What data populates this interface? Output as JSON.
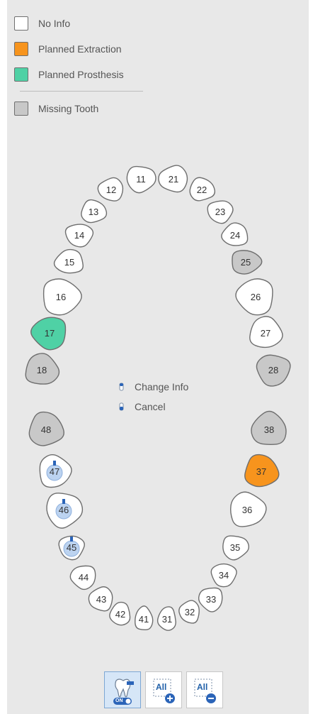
{
  "legend": {
    "items": [
      {
        "label": "No Info",
        "color": "#ffffff"
      },
      {
        "label": "Planned Extraction",
        "color": "#f7941d"
      },
      {
        "label": "Planned Prosthesis",
        "color": "#4fd1a5"
      },
      {
        "label": "Missing Tooth",
        "color": "#c8c8c8"
      }
    ]
  },
  "status_colors": {
    "none": "#ffffff",
    "extraction": "#f7941d",
    "prosthesis": "#4fd1a5",
    "missing": "#c8c8c8",
    "implant_marker": "#2b64b8"
  },
  "teeth": [
    {
      "number": "11",
      "status": "none"
    },
    {
      "number": "21",
      "status": "none"
    },
    {
      "number": "12",
      "status": "none"
    },
    {
      "number": "22",
      "status": "none"
    },
    {
      "number": "13",
      "status": "none"
    },
    {
      "number": "23",
      "status": "none"
    },
    {
      "number": "14",
      "status": "none"
    },
    {
      "number": "24",
      "status": "none"
    },
    {
      "number": "15",
      "status": "none"
    },
    {
      "number": "25",
      "status": "missing"
    },
    {
      "number": "16",
      "status": "none"
    },
    {
      "number": "26",
      "status": "none"
    },
    {
      "number": "17",
      "status": "prosthesis"
    },
    {
      "number": "27",
      "status": "none"
    },
    {
      "number": "18",
      "status": "missing"
    },
    {
      "number": "28",
      "status": "missing"
    },
    {
      "number": "48",
      "status": "missing"
    },
    {
      "number": "38",
      "status": "missing"
    },
    {
      "number": "47",
      "status": "none",
      "marker": true
    },
    {
      "number": "37",
      "status": "extraction"
    },
    {
      "number": "46",
      "status": "none",
      "marker": true
    },
    {
      "number": "36",
      "status": "none"
    },
    {
      "number": "45",
      "status": "none",
      "marker": true
    },
    {
      "number": "35",
      "status": "none"
    },
    {
      "number": "44",
      "status": "none"
    },
    {
      "number": "34",
      "status": "none"
    },
    {
      "number": "43",
      "status": "none"
    },
    {
      "number": "33",
      "status": "none"
    },
    {
      "number": "42",
      "status": "none"
    },
    {
      "number": "32",
      "status": "none"
    },
    {
      "number": "41",
      "status": "none"
    },
    {
      "number": "31",
      "status": "none"
    }
  ],
  "hints": {
    "change_info": "Change Info",
    "cancel": "Cancel"
  },
  "toolbar": {
    "toggle": {
      "label": "ON",
      "icon": "tooth-toggle-icon"
    },
    "select_all": {
      "label": "All",
      "icon": "plus-icon"
    },
    "deselect_all": {
      "label": "All",
      "icon": "minus-icon"
    }
  }
}
